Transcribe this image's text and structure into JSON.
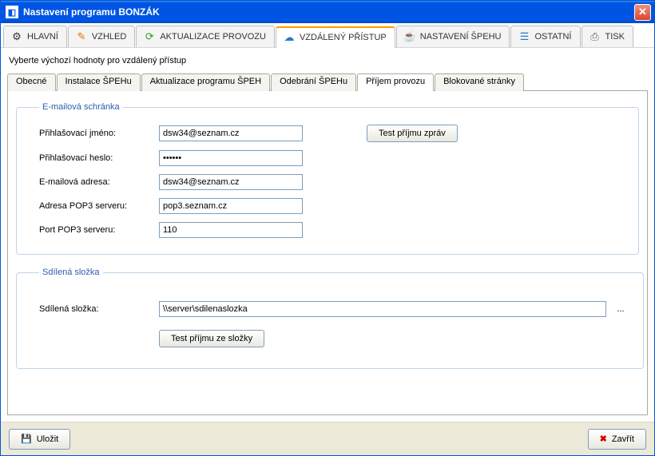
{
  "window": {
    "title": "Nastavení programu BONZÁK"
  },
  "mainTabs": {
    "t0": "HLAVNÍ",
    "t1": "VZHLED",
    "t2": "AKTUALIZACE PROVOZU",
    "t3": "VZDÁLENÝ PŘÍSTUP",
    "t4": "NASTAVENÍ ŠPEHU",
    "t5": "OSTATNÍ",
    "t6": "TISK"
  },
  "instruction": "Vyberte výchozí hodnoty pro vzdálený přístup",
  "subTabs": {
    "t0": "Obecné",
    "t1": "Instalace ŠPEHu",
    "t2": "Aktualizace programu ŠPEH",
    "t3": "Odebrání ŠPEHu",
    "t4": "Příjem provozu",
    "t5": "Blokované stránky"
  },
  "groups": {
    "email": {
      "legend": "E-mailová schránka",
      "fields": {
        "login_label": "Přihlašovací jméno:",
        "login_value": "dsw34@seznam.cz",
        "password_label": "Přihlašovací heslo:",
        "password_value": "••••••",
        "email_label": "E-mailová adresa:",
        "email_value": "dsw34@seznam.cz",
        "pop3_addr_label": "Adresa POP3 serveru:",
        "pop3_addr_value": "pop3.seznam.cz",
        "pop3_port_label": "Port POP3 serveru:",
        "pop3_port_value": "110"
      },
      "test_button": "Test příjmu zpráv"
    },
    "share": {
      "legend": "Sdílená složka",
      "fields": {
        "folder_label": "Sdílená složka:",
        "folder_value": "\\\\server\\sdilenaslozka"
      },
      "browse": "...",
      "test_button": "Test příjmu ze složky"
    }
  },
  "footer": {
    "save": "Uložit",
    "close": "Zavřít"
  }
}
